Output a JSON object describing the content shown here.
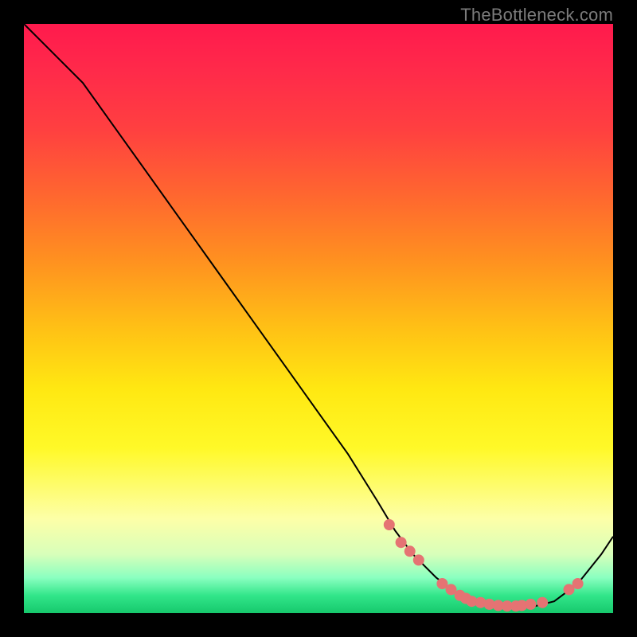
{
  "watermark": "TheBottleneck.com",
  "colors": {
    "dot": "#e57373",
    "curve": "#000000",
    "frame": "#000000"
  },
  "chart_data": {
    "type": "line",
    "title": "",
    "xlabel": "",
    "ylabel": "",
    "xlim": [
      0,
      100
    ],
    "ylim": [
      0,
      100
    ],
    "legend": false,
    "grid": false,
    "note": "Axes unlabeled; values estimated from gridless figure. x is horizontal fraction (%), y is vertical fraction (%) from bottom.",
    "series": [
      {
        "name": "curve",
        "x": [
          0,
          3,
          6,
          10,
          15,
          20,
          25,
          30,
          35,
          40,
          45,
          50,
          55,
          60,
          63,
          66,
          70,
          74,
          78,
          82,
          86,
          90,
          94,
          98,
          100
        ],
        "y": [
          100,
          97,
          94,
          90,
          83,
          76,
          69,
          62,
          55,
          48,
          41,
          34,
          27,
          19,
          14,
          10,
          6,
          3,
          1.5,
          1,
          1,
          2,
          5,
          10,
          13
        ]
      }
    ],
    "scatter_points": {
      "name": "highlighted-points",
      "x": [
        62,
        64,
        65.5,
        67,
        71,
        72.5,
        74,
        75,
        76,
        77.5,
        79,
        80.5,
        82,
        83.5,
        84.5,
        86,
        88,
        92.5,
        94
      ],
      "y": [
        15,
        12,
        10.5,
        9,
        5,
        4,
        3,
        2.5,
        2,
        1.8,
        1.5,
        1.3,
        1.2,
        1.2,
        1.3,
        1.5,
        1.8,
        4,
        5
      ]
    }
  }
}
